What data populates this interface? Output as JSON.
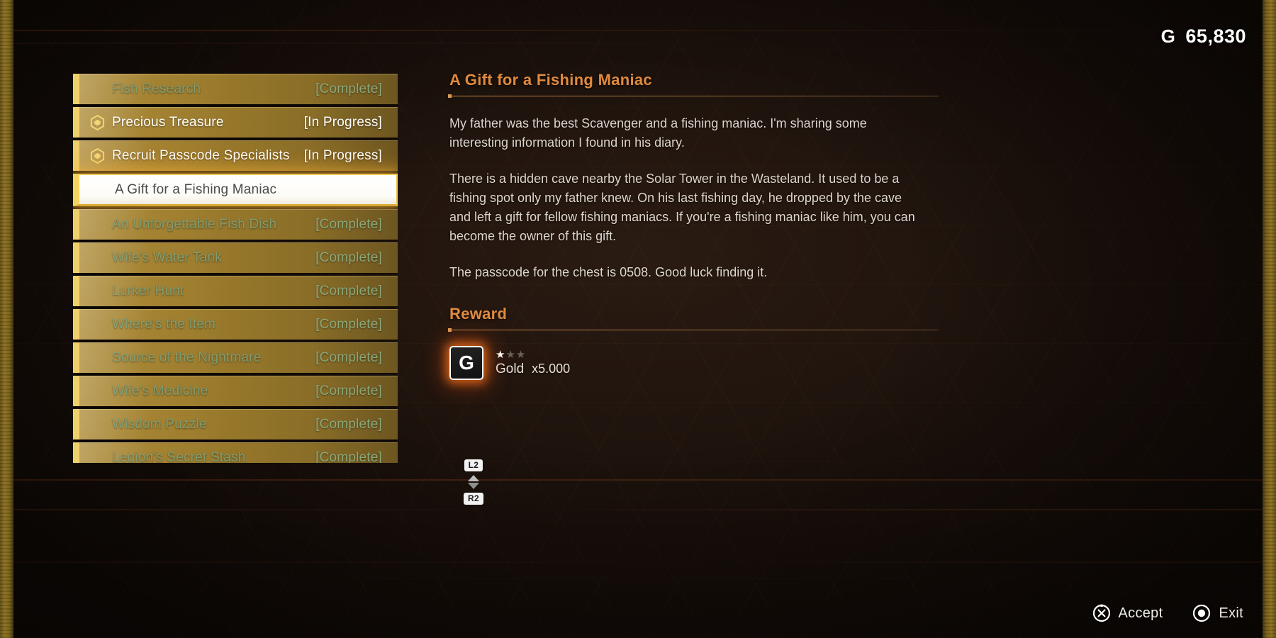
{
  "currency": {
    "symbol": "G",
    "amount": "65,830"
  },
  "quest_list": [
    {
      "name": "Fish Research",
      "status": "[Complete]",
      "state": "complete",
      "marker": "none"
    },
    {
      "name": "Precious Treasure",
      "status": "[In Progress]",
      "state": "in-progress",
      "marker": "hexagon-icon"
    },
    {
      "name": "Recruit Passcode Specialists",
      "status": "[In Progress]",
      "state": "in-progress",
      "marker": "hexagon-icon"
    },
    {
      "name": "A Gift for a Fishing Maniac",
      "status": "",
      "state": "selected",
      "marker": "none"
    },
    {
      "name": "An Unforgettable Fish Dish",
      "status": "[Complete]",
      "state": "complete",
      "marker": "none"
    },
    {
      "name": "Wife's Water Tank",
      "status": "[Complete]",
      "state": "complete",
      "marker": "none"
    },
    {
      "name": "Lurker Hunt",
      "status": "[Complete]",
      "state": "complete",
      "marker": "none"
    },
    {
      "name": "Where's the Item",
      "status": "[Complete]",
      "state": "complete",
      "marker": "none"
    },
    {
      "name": "Source of the Nightmare",
      "status": "[Complete]",
      "state": "complete",
      "marker": "none"
    },
    {
      "name": "Wife's Medicine",
      "status": "[Complete]",
      "state": "complete",
      "marker": "none"
    },
    {
      "name": "Wisdom Puzzle",
      "status": "[Complete]",
      "state": "complete",
      "marker": "none"
    },
    {
      "name": "Legion's Secret Stash",
      "status": "[Complete]",
      "state": "complete",
      "marker": "none"
    }
  ],
  "scroll_hint": {
    "up_key": "L2",
    "down_key": "R2"
  },
  "detail": {
    "title": "A Gift for a Fishing Maniac",
    "paragraphs": [
      "My father was the best Scavenger and a fishing maniac. I'm sharing some interesting information I found in his diary.",
      "There is a hidden cave nearby the Solar Tower in the Wasteland. It used to be a fishing spot only my father knew. On his last fishing day, he dropped by the cave and left a gift for fellow fishing maniacs. If you're a fishing maniac like him, you can become the owner of this gift.",
      "The passcode for the chest is 0508. Good luck finding it."
    ],
    "reward_heading": "Reward",
    "reward": {
      "icon_glyph": "G",
      "icon_name": "gold-currency-icon",
      "rarity_filled": 1,
      "rarity_total": 3,
      "name": "Gold",
      "quantity": "x5.000"
    }
  },
  "footer": {
    "prompts": [
      {
        "icon": "playstation-cross-icon",
        "label": "Accept"
      },
      {
        "icon": "playstation-circle-icon",
        "label": "Exit"
      }
    ]
  },
  "colors": {
    "accent_orange": "#e08a3e",
    "gold_row": "#9d7c2c",
    "gold_accent": "#f0d06a",
    "complete_text": "#7f9b70",
    "selected_bg": "#ffffff",
    "background": "#1a100b",
    "edge_band": "#9c7f27"
  }
}
